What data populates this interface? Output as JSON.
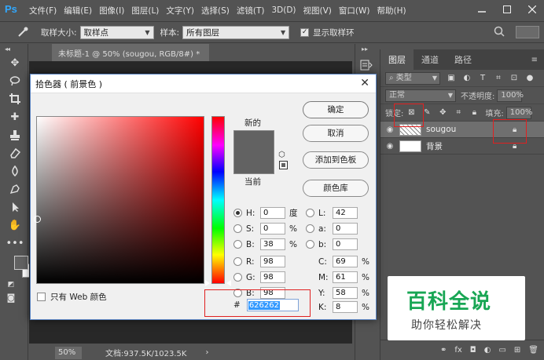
{
  "app": {
    "logo": "Ps"
  },
  "menu": [
    "文件(F)",
    "编辑(E)",
    "图像(I)",
    "图层(L)",
    "文字(Y)",
    "选择(S)",
    "滤镜(T)",
    "3D(D)",
    "视图(V)",
    "窗口(W)",
    "帮助(H)"
  ],
  "options": {
    "sample_size_label": "取样大小:",
    "sample_size_value": "取样点",
    "sample_label": "样本:",
    "sample_value": "所有图层",
    "show_ring_label": "显示取样环"
  },
  "document": {
    "tab_title": "未标题-1 @ 50% (sougou, RGB/8#) *",
    "zoom": "50%",
    "doc_info": "文档:937.5K/1023.5K"
  },
  "layers_panel": {
    "tabs": [
      "图层",
      "通道",
      "路径"
    ],
    "kind_filter": "类型",
    "blend_mode": "正常",
    "opacity_label": "不透明度:",
    "opacity_value": "100%",
    "lock_label": "锁定:",
    "fill_label": "填充:",
    "fill_value": "100%",
    "layers": [
      {
        "name": "sougou",
        "selected": true
      },
      {
        "name": "背景",
        "selected": false
      }
    ]
  },
  "color_picker": {
    "title": "拾色器 ( 前景色 )",
    "new_label": "新的",
    "current_label": "当前",
    "swatch_color": "#626262",
    "buttons": {
      "ok": "确定",
      "cancel": "取消",
      "add_swatch": "添加到色板",
      "libraries": "颜色库"
    },
    "hsb": [
      {
        "name": "H:",
        "value": "0",
        "unit": "度",
        "selected": true
      },
      {
        "name": "S:",
        "value": "0",
        "unit": "%",
        "selected": false
      },
      {
        "name": "B:",
        "value": "38",
        "unit": "%",
        "selected": false
      }
    ],
    "rgb": [
      {
        "name": "R:",
        "value": "98"
      },
      {
        "name": "G:",
        "value": "98"
      },
      {
        "name": "B:",
        "value": "98"
      }
    ],
    "lab": [
      {
        "name": "L:",
        "value": "42"
      },
      {
        "name": "a:",
        "value": "0"
      },
      {
        "name": "b:",
        "value": "0"
      }
    ],
    "cmyk": [
      {
        "name": "C:",
        "value": "69",
        "unit": "%"
      },
      {
        "name": "M:",
        "value": "61",
        "unit": "%"
      },
      {
        "name": "Y:",
        "value": "58",
        "unit": "%"
      },
      {
        "name": "K:",
        "value": "8",
        "unit": "%"
      }
    ],
    "hex_label": "#",
    "hex_value": "626262",
    "web_only_label": "只有 Web 颜色"
  },
  "watermark": {
    "title": "百科全说",
    "subtitle": "助你轻松解决"
  }
}
